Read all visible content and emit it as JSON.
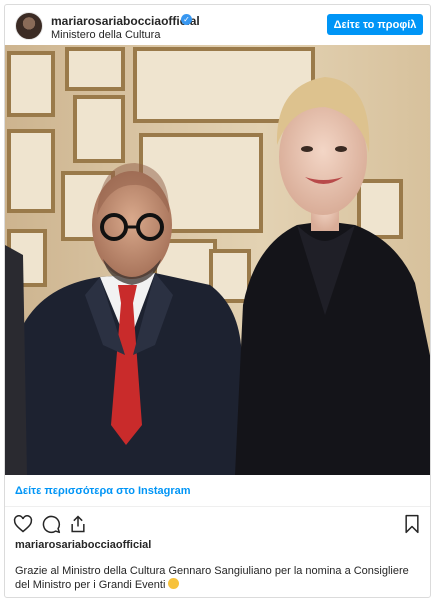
{
  "header": {
    "username": "mariarosariabocciaofficial",
    "location": "Ministero della Cultura",
    "profile_button": "Δείτε το προφίλ"
  },
  "post": {
    "more_link": "Δείτε περισσότερα στο Instagram",
    "owner": "mariarosariabocciaofficial",
    "caption": "Grazie al Ministro della Cultura Gennaro Sangiuliano per la nomina a Consigliere del Ministro per i Grandi Eventi"
  },
  "icons": {
    "verified": "verified-badge-icon",
    "like": "heart-icon",
    "comment": "comment-icon",
    "share": "share-icon",
    "save": "bookmark-icon",
    "emoji": "star-struck-emoji-icon"
  },
  "colors": {
    "accent": "#0095f6",
    "verified": "#3897f0",
    "text": "#262626"
  }
}
